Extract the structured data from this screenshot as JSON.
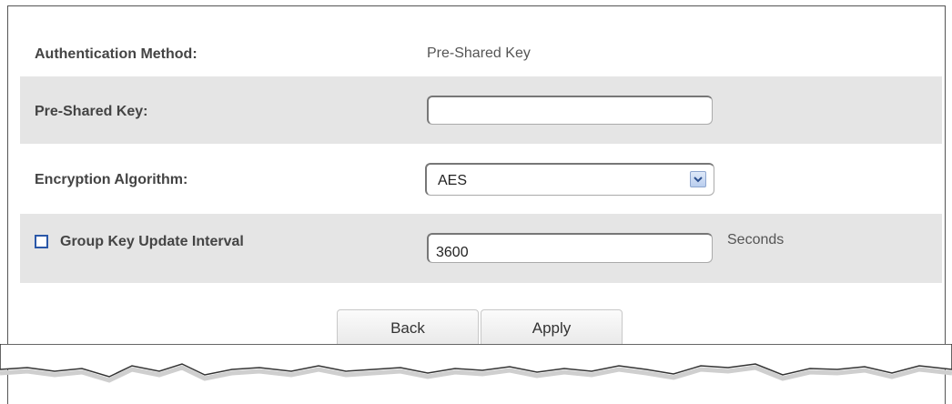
{
  "form": {
    "auth_method_label": "Authentication Method:",
    "auth_method_value": "Pre-Shared Key",
    "psk_label": "Pre-Shared Key:",
    "psk_value": "",
    "encryption_label": "Encryption Algorithm:",
    "encryption_value": "AES",
    "group_key_label": "Group Key Update Interval",
    "group_key_checked": false,
    "group_key_value": "3600",
    "group_key_unit": "Seconds"
  },
  "buttons": {
    "back_label": "Back",
    "apply_label": "Apply"
  },
  "icons": {
    "dropdown": "chevron-down-icon",
    "checkbox": "checkbox-icon"
  }
}
